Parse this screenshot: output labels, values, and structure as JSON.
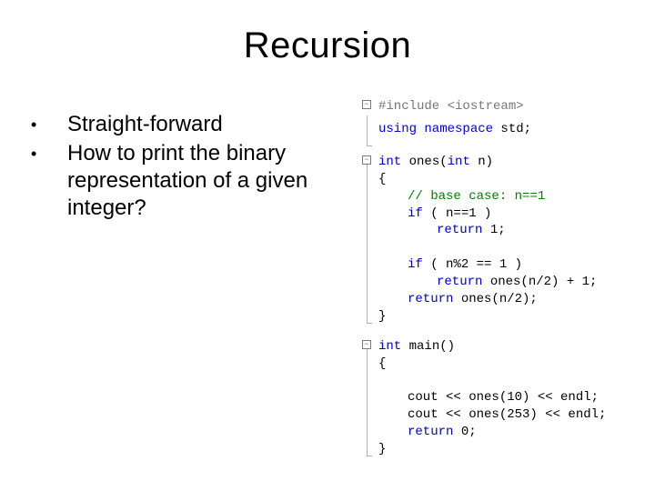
{
  "title": "Recursion",
  "bullets": [
    "Straight-forward",
    "How to print the binary representation of a given integer?"
  ],
  "code": {
    "b1": {
      "l1": "#include <iostream>"
    },
    "gap1": {
      "l1": "using namespace std;"
    },
    "b2": {
      "l1_kw": "int",
      "l1_rest": " ones(",
      "l1_kw2": "int",
      "l1_rest2": " n)",
      "l2": "{",
      "l3": "// base case: n==1",
      "l4_kw": "if",
      "l4_rest": " ( n==1 )",
      "l5_kw": "return",
      "l5_rest": " 1;",
      "l6_kw": "if",
      "l6_rest": " ( n%2 == 1 )",
      "l7_kw": "return",
      "l7_rest": " ones(n/2) + 1;",
      "l8_kw": "return",
      "l8_rest": " ones(n/2);",
      "l9": "}"
    },
    "b3": {
      "l1_kw": "int",
      "l1_rest": " main()",
      "l2": "{",
      "l3": "cout << ones(10) << endl;",
      "l4": "cout << ones(253) << endl;",
      "l5_kw": "return",
      "l5_rest": " 0;",
      "l6": "}"
    }
  }
}
